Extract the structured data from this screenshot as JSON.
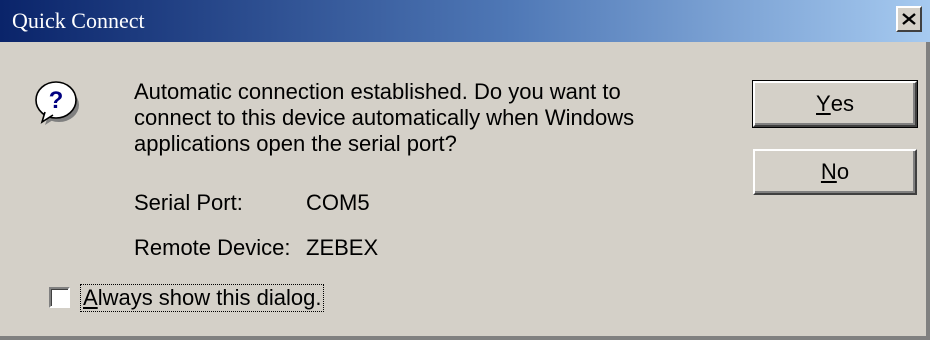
{
  "window": {
    "title": "Quick Connect",
    "close_icon": "close-icon"
  },
  "dialog": {
    "icon": "question-icon",
    "message": "Automatic connection established.  Do you want to connect to this device automatically when Windows applications open the serial port?",
    "fields": [
      {
        "label": "Serial Port:",
        "value": "COM5"
      },
      {
        "label": "Remote Device:",
        "value": "ZEBEX"
      }
    ],
    "checkbox": {
      "label_accel": "A",
      "label_rest": "lways show this dialog.",
      "checked": false
    }
  },
  "buttons": {
    "yes": {
      "accel": "Y",
      "rest": "es"
    },
    "no": {
      "accel": "N",
      "rest": "o"
    }
  }
}
